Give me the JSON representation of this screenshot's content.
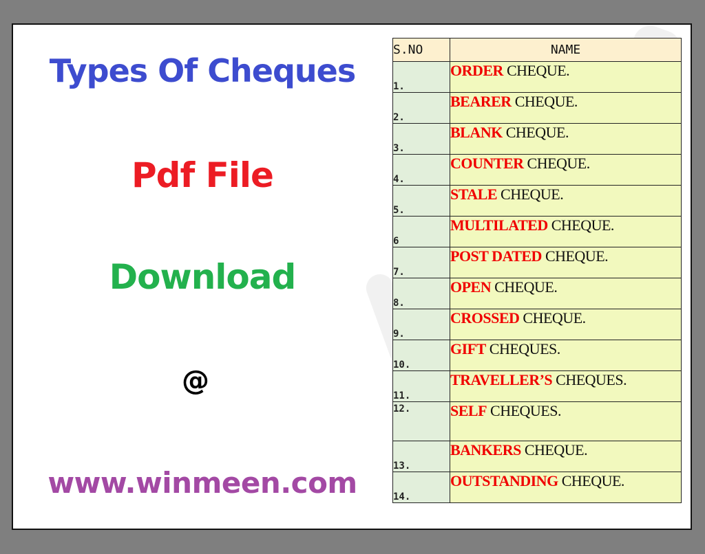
{
  "left_panel": {
    "title": "Types Of Cheques",
    "subtitle": "Pdf File",
    "action": "Download",
    "at_symbol": "@",
    "website": "www.winmeen.com"
  },
  "colors": {
    "title": "#3d4ccf",
    "subtitle": "#ec1c24",
    "action": "#23b14d",
    "website": "#a349a4",
    "keyword": "#f00000",
    "header_bg": "#fdf0cf",
    "sno_bg": "#e2efdb",
    "name_bg": "#f2f9be"
  },
  "table": {
    "headers": {
      "sno": "S.NO",
      "name": "NAME"
    },
    "rows": [
      {
        "sno": "1.",
        "keyword": "ORDER",
        "suffix": " CHEQUE."
      },
      {
        "sno": "2.",
        "keyword": "BEARER",
        "suffix": " CHEQUE."
      },
      {
        "sno": "3.",
        "keyword": "BLANK",
        "suffix": " CHEQUE."
      },
      {
        "sno": "4.",
        "keyword": "COUNTER",
        "suffix": " CHEQUE."
      },
      {
        "sno": "5.",
        "keyword": "STALE",
        "suffix": " CHEQUE."
      },
      {
        "sno": "6",
        "keyword": "MULTILATED",
        "suffix": " CHEQUE."
      },
      {
        "sno": "7.",
        "keyword": "POST DATED",
        "suffix": " CHEQUE."
      },
      {
        "sno": "8.",
        "keyword": "OPEN",
        "suffix": " CHEQUE."
      },
      {
        "sno": "9.",
        "keyword": "CROSSED",
        "suffix": " CHEQUE."
      },
      {
        "sno": "10.",
        "keyword": "GIFT",
        "suffix": " CHEQUES."
      },
      {
        "sno": "11.",
        "keyword": "TRAVELLER’S",
        "suffix": " CHEQUES."
      },
      {
        "sno": "12.",
        "keyword": "SELF",
        "suffix": " CHEQUES."
      },
      {
        "sno": "13.",
        "keyword": "BANKERS",
        "suffix": " CHEQUE."
      },
      {
        "sno": "14.",
        "keyword": "OUTSTANDING",
        "suffix": " CHEQUE."
      }
    ]
  }
}
